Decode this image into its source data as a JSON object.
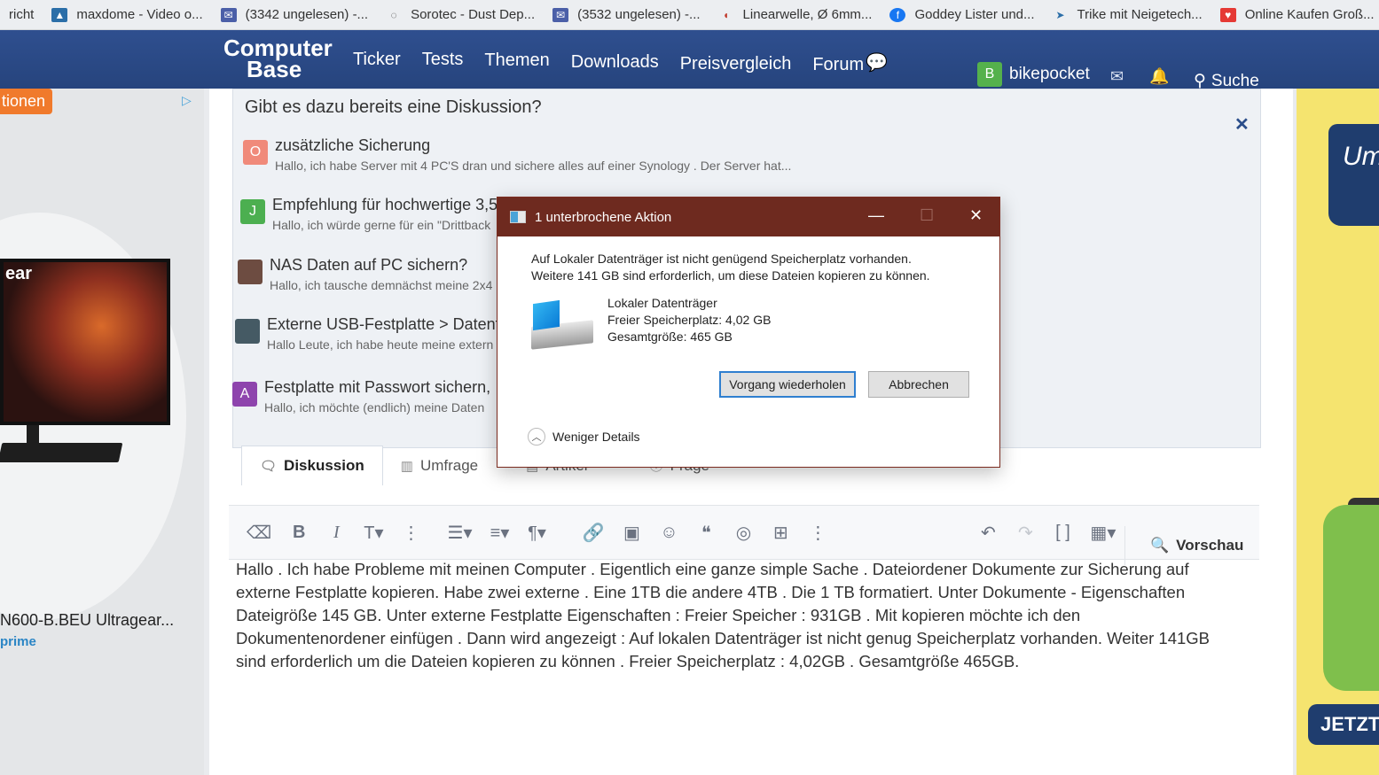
{
  "bookmarks": [
    {
      "label": "richt",
      "icon": "bookmark-icon"
    },
    {
      "label": "maxdome - Video o...",
      "icon": "maxdome-icon"
    },
    {
      "label": "(3342 ungelesen) -...",
      "icon": "mail-icon"
    },
    {
      "label": "Sorotec - Dust Dep...",
      "icon": "sorotec-icon"
    },
    {
      "label": "(3532 ungelesen) -...",
      "icon": "mail-icon"
    },
    {
      "label": "Linearwelle, Ø 6mm...",
      "icon": "bookmark-icon"
    },
    {
      "label": "Goddey Lister und...",
      "icon": "facebook-icon"
    },
    {
      "label": "Trike mit Neigetech...",
      "icon": "bookmark-icon"
    },
    {
      "label": "Online Kaufen Groß...",
      "icon": "bookmark-icon"
    }
  ],
  "site": {
    "logo_line1": "Computer",
    "logo_line2": "Base",
    "nav": [
      "Ticker",
      "Tests",
      "Themen",
      "Downloads",
      "Preisvergleich",
      "Forum"
    ],
    "user_initial": "B",
    "username": "bikepocket",
    "search_label": "Suche",
    "brand_color": "#2b4a86"
  },
  "leftad": {
    "tab_label": "tionen",
    "monitor_text": "ear",
    "product_name": "N600-B.BEU Ultragear...",
    "prime": "prime"
  },
  "rightad": {
    "jar_text": "Um",
    "cta": "JETZT"
  },
  "suggestions": {
    "title": "Gibt es dazu bereits eine Diskussion?",
    "threads": [
      {
        "initial": "O",
        "color": "#f08a7a",
        "title": "zusätzliche Sicherung",
        "excerpt": "Hallo, ich habe Server mit 4 PC'S dran und sichere alles auf einer Synology . Der Server hat..."
      },
      {
        "initial": "J",
        "color": "#4caf50",
        "title": "Empfehlung für hochwertige 3,5",
        "excerpt": "Hallo, ich würde gerne für ein \"Drittback"
      },
      {
        "initial": "",
        "color": "#6d4c41",
        "title": "NAS Daten auf PC sichern?",
        "excerpt": "Hallo, ich tausche demnächst meine 2x4"
      },
      {
        "initial": "",
        "color": "#455a64",
        "title": "Externe USB-Festplatte > Datent",
        "excerpt": "Hallo Leute, ich habe heute meine extern"
      },
      {
        "initial": "A",
        "color": "#8e44ad",
        "title": "Festplatte mit Passwort sichern,",
        "excerpt": "Hallo, ich möchte (endlich) meine Daten"
      }
    ]
  },
  "tabs": [
    {
      "label": "Diskussion",
      "icon": "chat-icon"
    },
    {
      "label": "Umfrage",
      "icon": "chart-icon"
    },
    {
      "label": "Artikel",
      "icon": "document-icon"
    },
    {
      "label": "Frage",
      "icon": "question-icon"
    }
  ],
  "editor": {
    "preview_label": "Vorschau",
    "lines": [
      "Hallo . Ich habe Probleme mit meinen Computer . Eigentlich eine ganze simple Sache . Dateiordener Dokumente zur Sicherung auf",
      "externe Festplatte kopieren. Habe zwei externe . Eine 1TB die andere 4TB . Die 1 TB formatiert. Unter Dokumente - Eigenschaften",
      "Dateigröße 145 GB. Unter externe Festplatte Eigenschaften :  Freier Speicher : 931GB . Mit kopieren möchte ich den",
      "Dokumentenordener einfügen . Dann wird angezeigt : Auf lokalen Datenträger ist nicht genug Speicherplatz vorhanden. Weiter 141GB",
      "sind erforderlich um die Dateien kopieren zu können . Freier Speicherplatz : 4,02GB . Gesamtgröße 465GB."
    ]
  },
  "dialog": {
    "title": "1 unterbrochene Aktion",
    "message_line1": "Auf Lokaler Datenträger ist nicht genügend Speicherplatz vorhanden.",
    "message_line2": "Weitere 141 GB sind erforderlich, um diese Dateien kopieren zu können.",
    "drive_name": "Lokaler Datenträger",
    "free_space": "Freier Speicherplatz: 4,02 GB",
    "total_size": "Gesamtgröße: 465 GB",
    "retry_label": "Vorgang wiederholen",
    "cancel_label": "Abbrechen",
    "less_details": "Weniger Details",
    "title_color": "#6e2a1f"
  }
}
